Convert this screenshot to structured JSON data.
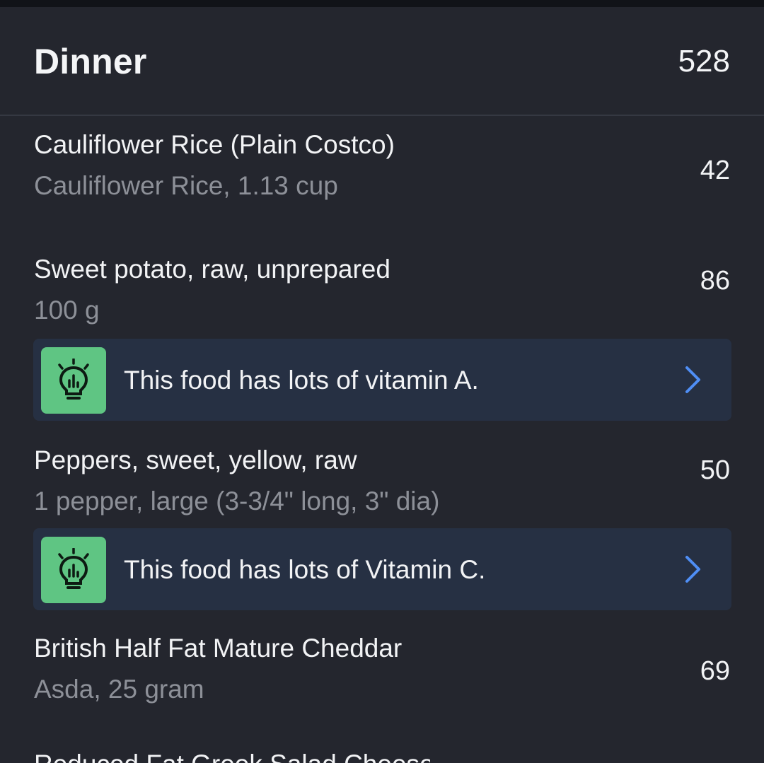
{
  "meal": {
    "title": "Dinner",
    "total_calories": "528"
  },
  "foods": [
    {
      "name": "Cauliflower Rice (Plain Costco)",
      "detail": "Cauliflower Rice, 1.13 cup",
      "calories": "42"
    },
    {
      "name": "Sweet potato, raw, unprepared",
      "detail": "100 g",
      "calories": "86",
      "tip": {
        "text": "This food has lots of vitamin A.",
        "icon": "lightbulb-chart-icon"
      }
    },
    {
      "name": "Peppers, sweet, yellow, raw",
      "detail": "1 pepper, large (3-3/4\" long, 3\" dia)",
      "calories": "50",
      "tip": {
        "text": "This food has lots of Vitamin C.",
        "icon": "lightbulb-chart-icon"
      }
    },
    {
      "name": "British Half Fat Mature Cheddar",
      "detail": "Asda, 25 gram",
      "calories": "69"
    }
  ],
  "partial_row": {
    "name": "Reduced Fat Greek Salad Cheese"
  },
  "colors": {
    "background": "#24262e",
    "tip_background": "#263043",
    "tip_icon_background": "#5fc583",
    "chevron": "#4f8ef5",
    "secondary_text": "#8d9098"
  }
}
